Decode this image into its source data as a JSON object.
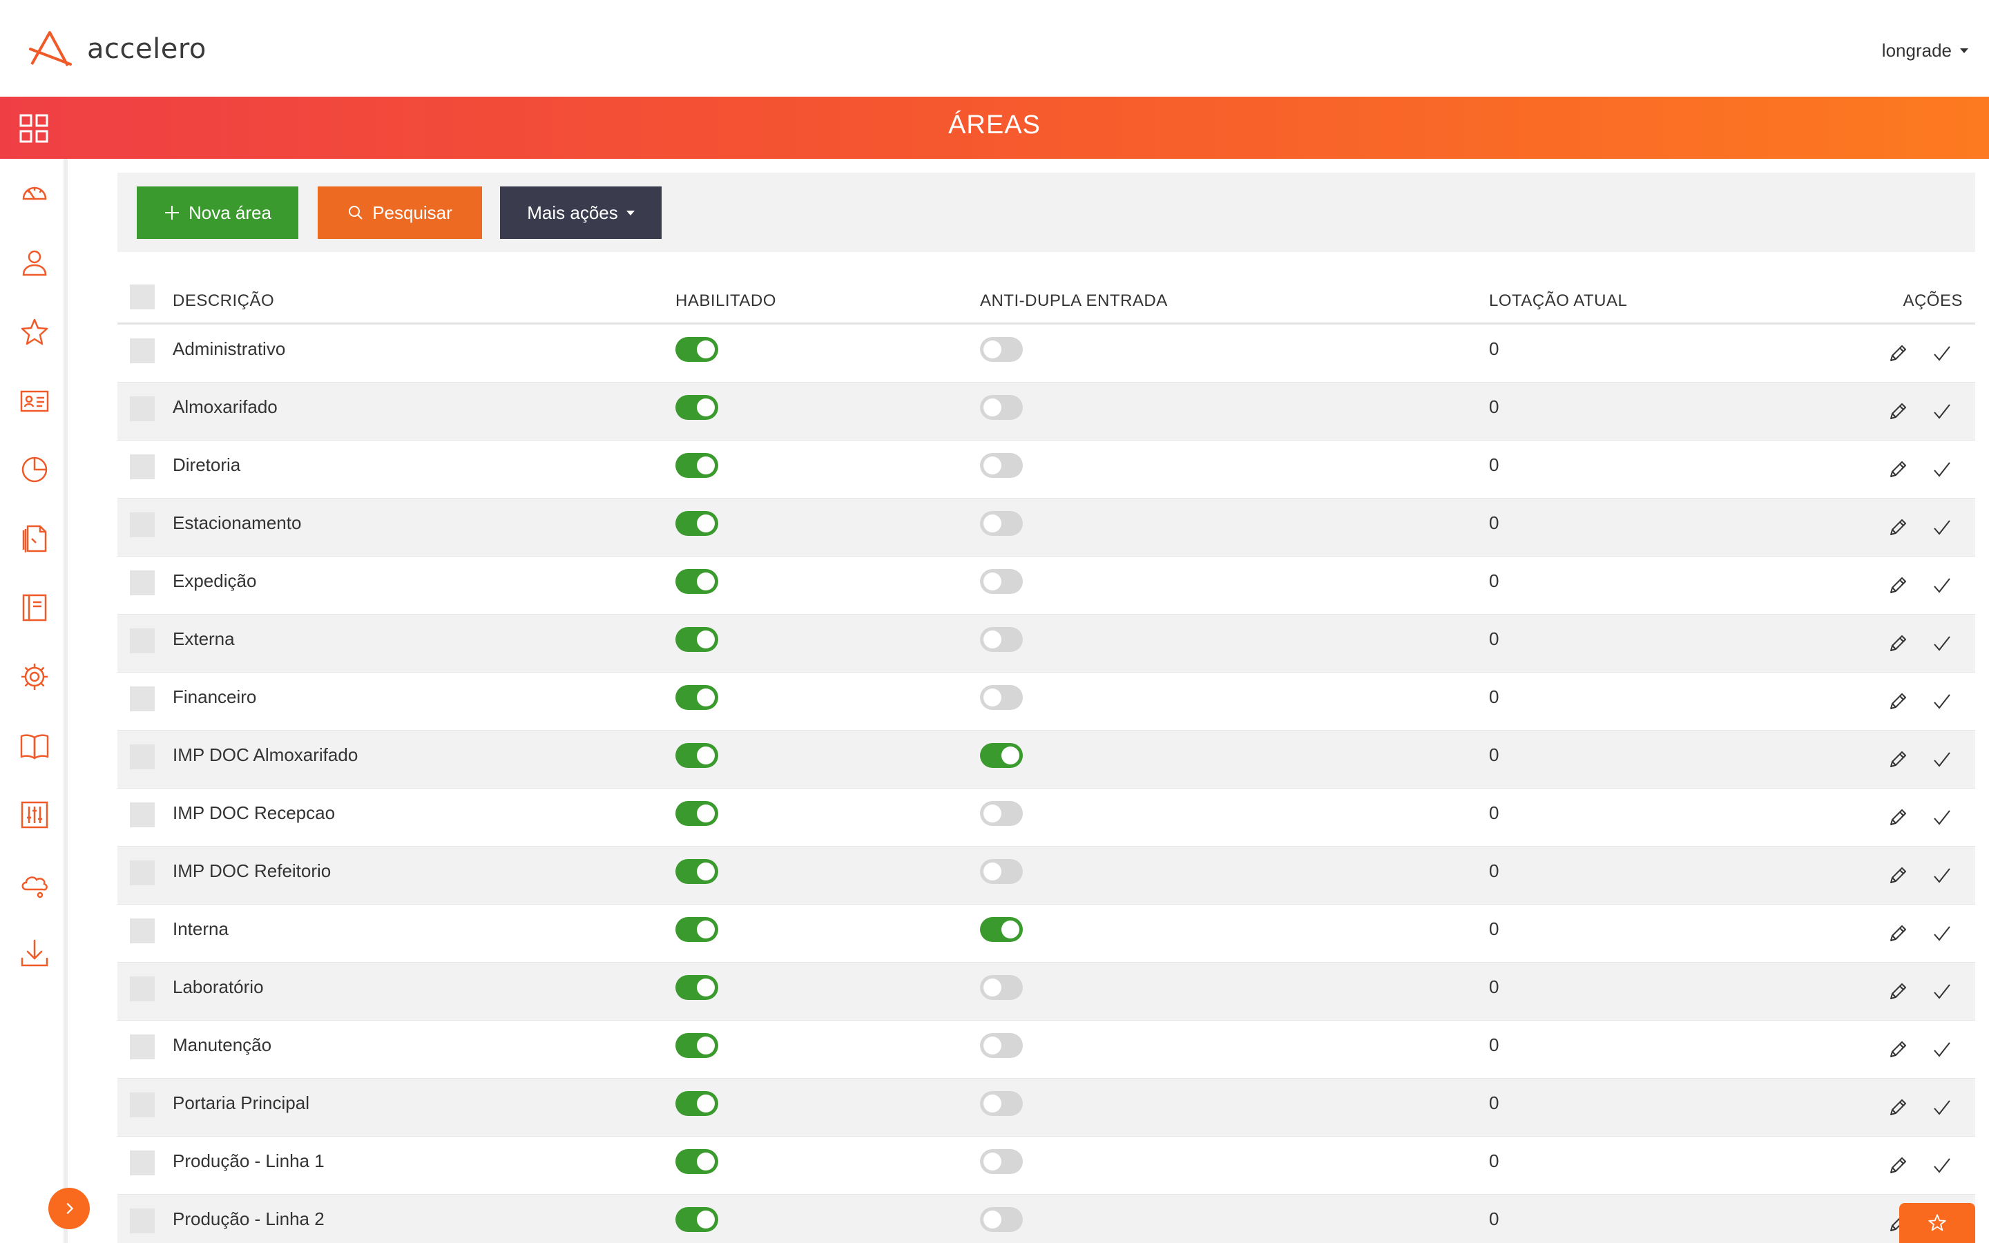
{
  "header": {
    "logo_text": "accelero",
    "user_name": "longrade"
  },
  "titlebar": {
    "title": "ÁREAS"
  },
  "toolbar": {
    "new_label": "Nova área",
    "search_label": "Pesquisar",
    "more_label": "Mais ações"
  },
  "sidebar": {
    "icons": [
      "dashboard-icon",
      "user-icon",
      "star-icon",
      "id-card-icon",
      "pie-chart-icon",
      "documents-icon",
      "notebook-icon",
      "gear-icon",
      "book-icon",
      "sliders-icon",
      "cloud-icon",
      "download-icon"
    ]
  },
  "table": {
    "columns": {
      "description": "DESCRIÇÃO",
      "enabled": "HABILITADO",
      "anti_passback": "ANTI-DUPLA ENTRADA",
      "occupancy": "LOTAÇÃO ATUAL",
      "actions": "AÇÕES"
    },
    "rows": [
      {
        "description": "Administrativo",
        "enabled": true,
        "anti_passback": false,
        "occupancy": "0"
      },
      {
        "description": "Almoxarifado",
        "enabled": true,
        "anti_passback": false,
        "occupancy": "0"
      },
      {
        "description": "Diretoria",
        "enabled": true,
        "anti_passback": false,
        "occupancy": "0"
      },
      {
        "description": "Estacionamento",
        "enabled": true,
        "anti_passback": false,
        "occupancy": "0"
      },
      {
        "description": "Expedição",
        "enabled": true,
        "anti_passback": false,
        "occupancy": "0"
      },
      {
        "description": "Externa",
        "enabled": true,
        "anti_passback": false,
        "occupancy": "0"
      },
      {
        "description": "Financeiro",
        "enabled": true,
        "anti_passback": false,
        "occupancy": "0"
      },
      {
        "description": "IMP DOC Almoxarifado",
        "enabled": true,
        "anti_passback": true,
        "occupancy": "0"
      },
      {
        "description": "IMP DOC Recepcao",
        "enabled": true,
        "anti_passback": false,
        "occupancy": "0"
      },
      {
        "description": "IMP DOC Refeitorio",
        "enabled": true,
        "anti_passback": false,
        "occupancy": "0"
      },
      {
        "description": "Interna",
        "enabled": true,
        "anti_passback": true,
        "occupancy": "0"
      },
      {
        "description": "Laboratório",
        "enabled": true,
        "anti_passback": false,
        "occupancy": "0"
      },
      {
        "description": "Manutenção",
        "enabled": true,
        "anti_passback": false,
        "occupancy": "0"
      },
      {
        "description": "Portaria Principal",
        "enabled": true,
        "anti_passback": false,
        "occupancy": "0"
      },
      {
        "description": "Produção - Linha 1",
        "enabled": true,
        "anti_passback": false,
        "occupancy": "0"
      },
      {
        "description": "Produção - Linha 2",
        "enabled": true,
        "anti_passback": false,
        "occupancy": "0"
      }
    ]
  },
  "colors": {
    "accent_orange": "#f96a1e",
    "gradient_start": "#ef3f45",
    "gradient_end": "#fd7a20",
    "success_green": "#3a9a2e",
    "dark_button": "#3a3b4d"
  }
}
